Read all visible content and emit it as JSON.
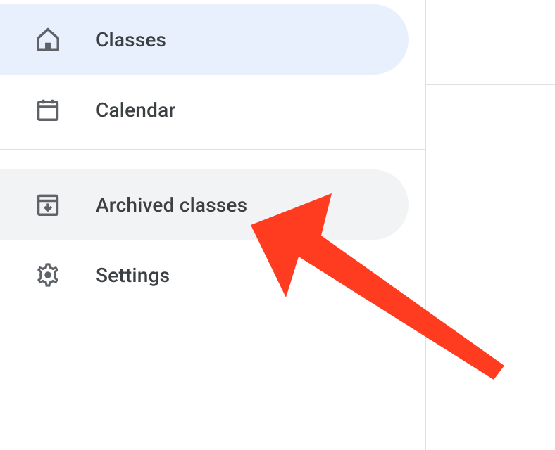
{
  "sidebar": {
    "items": [
      {
        "label": "Classes",
        "icon": "home"
      },
      {
        "label": "Calendar",
        "icon": "calendar"
      },
      {
        "label": "Archived classes",
        "icon": "archive"
      },
      {
        "label": "Settings",
        "icon": "gear"
      }
    ]
  },
  "colors": {
    "selected_bg": "#e8f0fe",
    "hover_bg": "#f1f3f4",
    "text": "#3c4043",
    "icon": "#5f6368",
    "arrow": "#ff3b20"
  }
}
